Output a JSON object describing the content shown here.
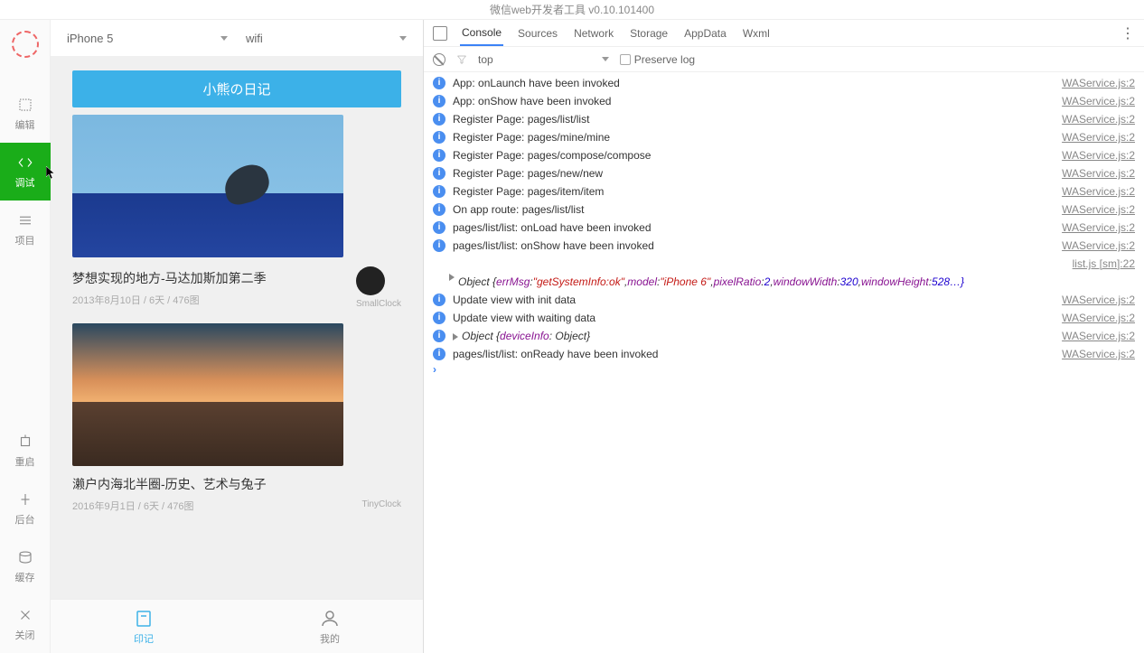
{
  "window_title": "微信web开发者工具 v0.10.101400",
  "leftbar": {
    "edit": "编辑",
    "debug": "调试",
    "project": "项目",
    "restart": "重启",
    "background": "后台",
    "cache": "缓存",
    "close": "关闭"
  },
  "device": {
    "model": "iPhone 5",
    "network": "wifi"
  },
  "app": {
    "header": "小熊の日记",
    "cards": [
      {
        "title": "梦想实现的地方-马达加斯加第二季",
        "meta": "2013年8月10日 / 6天 / 476图",
        "author": "SmallClock"
      },
      {
        "title": "濑户内海北半圈-历史、艺术与兔子",
        "meta": "2016年9月1日 / 6天 / 476图",
        "author": "TinyClock"
      }
    ],
    "tabs": {
      "memo": "印记",
      "mine": "我的"
    }
  },
  "devtools": {
    "tabs": {
      "console": "Console",
      "sources": "Sources",
      "network": "Network",
      "storage": "Storage",
      "appdata": "AppData",
      "wxml": "Wxml"
    },
    "filter": {
      "context": "top",
      "preserve": "Preserve log"
    },
    "src_default": "WAService.js:2",
    "src_list": "list.js [sm]:22",
    "logs": [
      "App: onLaunch have been invoked",
      "App: onShow have been invoked",
      "Register Page: pages/list/list",
      "Register Page: pages/mine/mine",
      "Register Page: pages/compose/compose",
      "Register Page: pages/new/new",
      "Register Page: pages/item/item",
      "On app route: pages/list/list",
      "pages/list/list: onLoad have been invoked",
      "pages/list/list: onShow have been invoked"
    ],
    "obj1": {
      "pre": "Object {",
      "errMsg": "errMsg",
      "errVal": "\"getSystemInfo:ok\"",
      "model": "model",
      "modelVal": "\"iPhone 6\"",
      "pixelRatio": "pixelRatio",
      "prVal": "2",
      "windowWidth": "windowWidth",
      "wwVal": "320",
      "windowHeight": "windowHeight",
      "tail": "528…}"
    },
    "logs2": [
      "Update view with init data",
      "Update view with waiting data"
    ],
    "obj2": {
      "pre": "Object {",
      "prop": "deviceInfo",
      "val": "Object",
      "post": "}"
    },
    "logs3": [
      "pages/list/list: onReady have been invoked"
    ]
  }
}
